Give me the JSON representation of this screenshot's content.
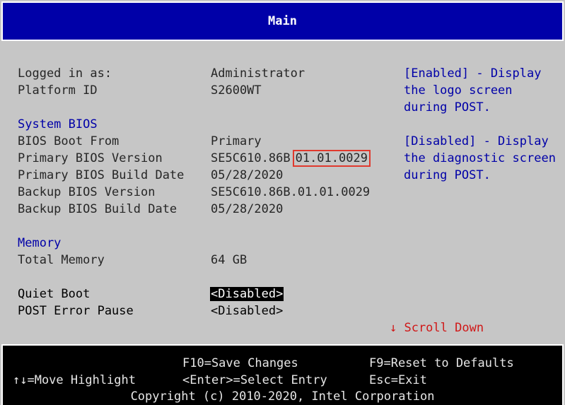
{
  "header": {
    "title": "Main"
  },
  "rows": {
    "logged_in_label": "Logged in as:",
    "logged_in_value": "Administrator",
    "platform_label": "Platform ID",
    "platform_value": "S2600WT",
    "system_bios_heading": "System BIOS",
    "boot_from_label": "BIOS Boot From",
    "boot_from_value": "Primary",
    "primary_ver_label": "Primary BIOS Version",
    "primary_ver_prefix": "SE5C610.86B",
    "primary_ver_highlight": "01.01.0029",
    "primary_date_label": "Primary BIOS Build Date",
    "primary_date_value": "05/28/2020",
    "backup_ver_label": "Backup BIOS Version",
    "backup_ver_value": "SE5C610.86B.01.01.0029",
    "backup_date_label": "Backup BIOS Build Date",
    "backup_date_value": "05/28/2020",
    "memory_heading": "Memory",
    "total_memory_label": "Total Memory",
    "total_memory_value": "64 GB",
    "quiet_boot_label": "Quiet Boot",
    "quiet_boot_value": "<Disabled>",
    "post_error_label": "POST Error Pause",
    "post_error_value": "<Disabled>"
  },
  "help": {
    "line1": "[Enabled] - Display",
    "line2": "the logo screen",
    "line3": "during POST.",
    "line4": "[Disabled] - Display",
    "line5": "the diagnostic screen",
    "line6": "during POST."
  },
  "scroll_hint": "↓ Scroll Down",
  "footer": {
    "save": "F10=Save Changes",
    "reset": "F9=Reset to Defaults",
    "move": "↑↓=Move Highlight",
    "select": "<Enter>=Select Entry",
    "exit": "Esc=Exit",
    "copyright": "Copyright (c) 2010-2020, Intel Corporation"
  },
  "colors": {
    "header_bg": "#0000a8",
    "body_bg": "#c6c6c6",
    "footer_bg": "#000000",
    "highlight_box": "#e0392d"
  }
}
